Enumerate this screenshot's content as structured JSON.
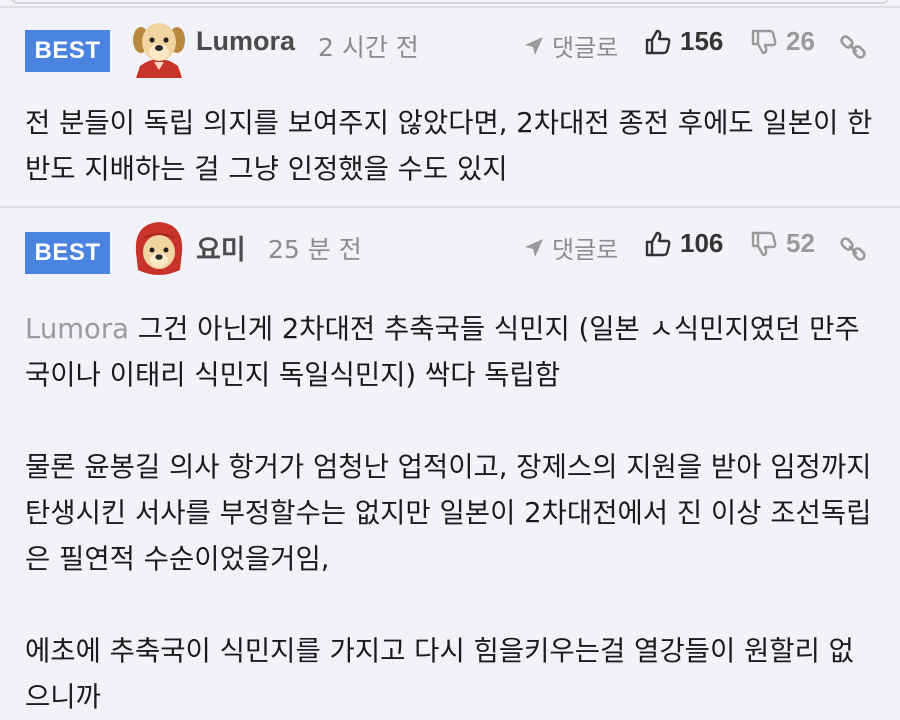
{
  "comments": [
    {
      "badge": "BEST",
      "username": "Lumora",
      "time": "2 시간 전",
      "reply_label": "댓글로",
      "likes": "156",
      "dislikes": "26",
      "avatar_icon": "puppy-avatar",
      "paragraphs": [
        "전 분들이 독립 의지를 보여주지 않았다면, 2차대전 종전 후에도 일본이 한반도 지배하는 걸 그냥 인정했을 수도 있지"
      ]
    },
    {
      "badge": "BEST",
      "username": "요미",
      "time": "25 분 전",
      "reply_label": "댓글로",
      "likes": "106",
      "dislikes": "52",
      "avatar_icon": "puppy-red-hood-avatar",
      "mention": "Lumora",
      "paragraphs": [
        "그건 아닌게 2차대전 추축국들 식민지 (일본 ㅅ식민지였던 만주국이나 이태리 식민지 독일식민지) 싹다 독립함",
        "물론 윤봉길 의사 항거가 엄청난 업적이고, 장제스의 지원을 받아 임정까지 탄생시킨 서사를 부정할수는 없지만 일본이 2차대전에서 진 이상 조선독립은 필연적 수순이었을거임,",
        "에초에 추축국이 식민지를 가지고 다시 힘을키우는걸 열강들이 원할리 없으니까"
      ]
    }
  ],
  "colors": {
    "badge": "#4a83e0",
    "background": "#f2f3f8",
    "muted": "#8c8c8c"
  }
}
